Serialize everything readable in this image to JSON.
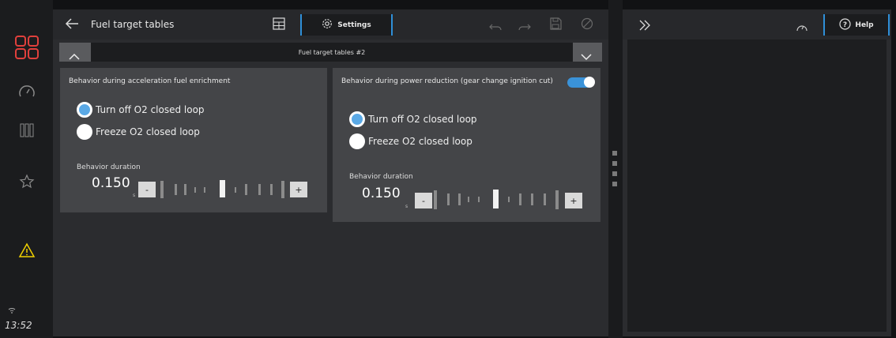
{
  "sidebar": {
    "time": "13:52"
  },
  "header": {
    "title": "Fuel target tables",
    "settings_label": "Settings"
  },
  "subheader": {
    "title": "Fuel target tables #2"
  },
  "card_left": {
    "title": "Behavior during acceleration fuel enrichment",
    "option1": "Turn off O2 closed loop",
    "option2": "Freeze O2 closed loop",
    "selected": 1,
    "duration_label": "Behavior duration",
    "duration_value": "0.150",
    "duration_unit": "s",
    "minus": "-",
    "plus": "+"
  },
  "card_right": {
    "title": "Behavior during power reduction (gear change ignition cut)",
    "toggle_on": true,
    "option1": "Turn off O2 closed loop",
    "option2": "Freeze O2 closed loop",
    "selected": 1,
    "duration_label": "Behavior duration",
    "duration_value": "0.150",
    "duration_unit": "s",
    "minus": "-",
    "plus": "+"
  },
  "right_panel": {
    "help_label": "Help"
  },
  "colors": {
    "accent": "#3a92d8",
    "warning": "#f0d000",
    "logo": "#e0403c"
  }
}
